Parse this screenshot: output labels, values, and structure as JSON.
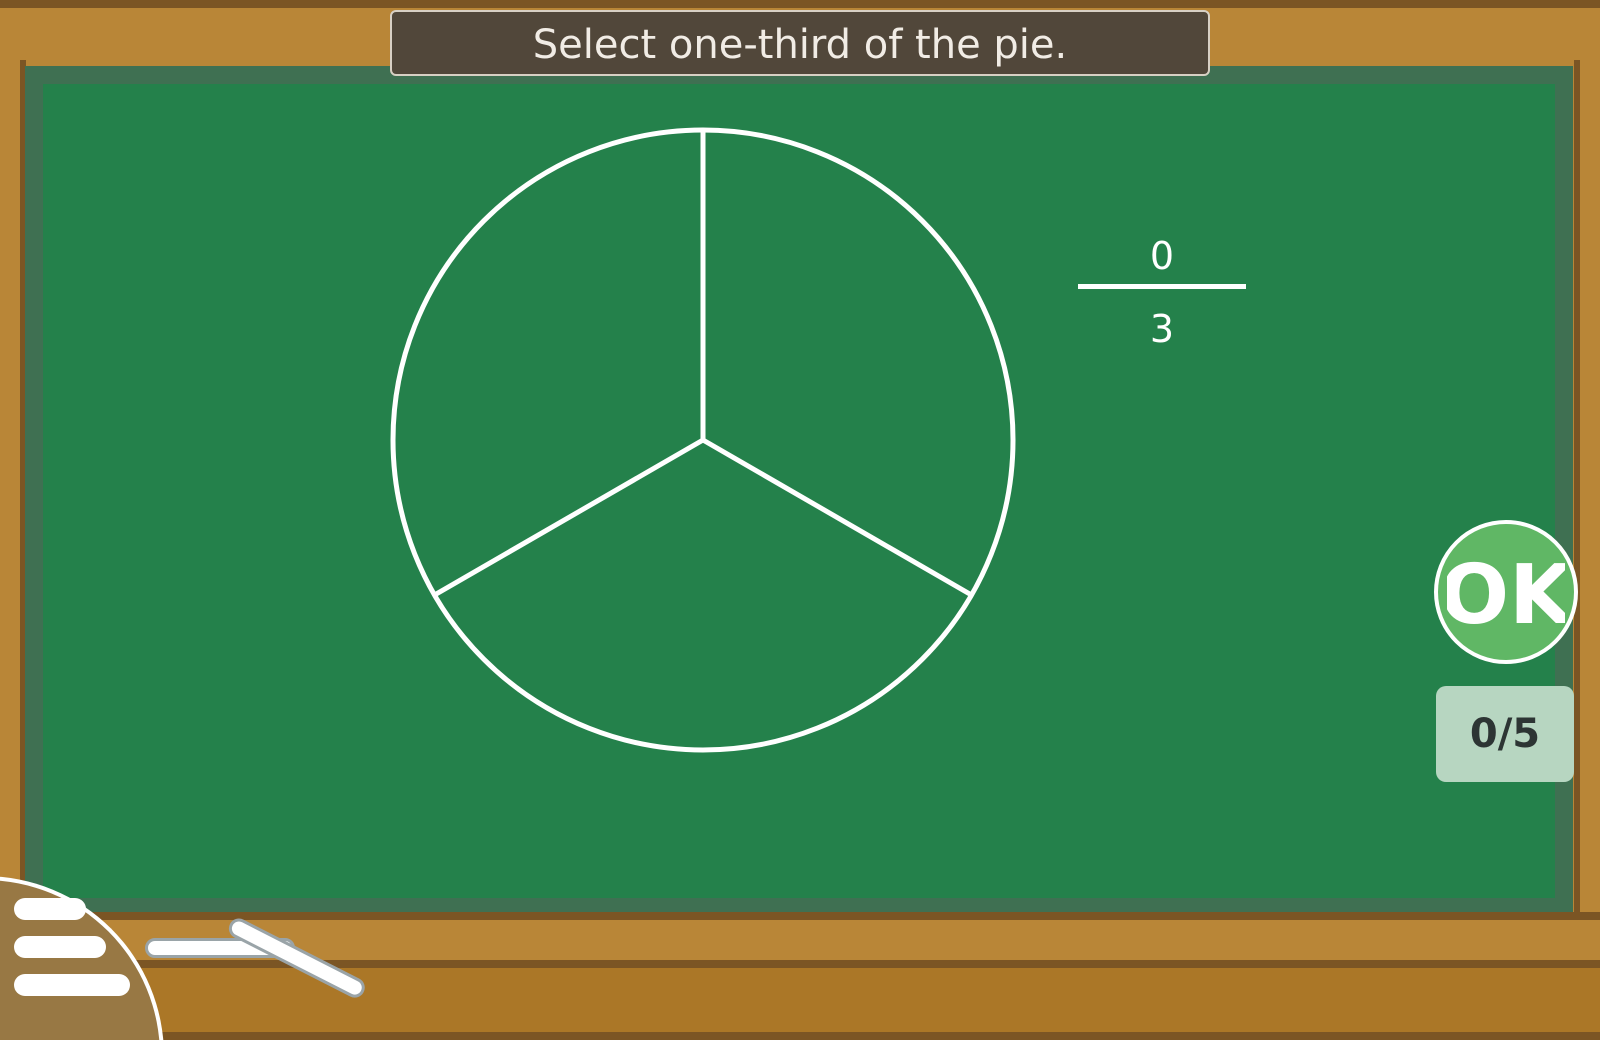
{
  "prompt": "Select one-third of the pie.",
  "fraction": {
    "numerator": "0",
    "denominator": "3"
  },
  "pie": {
    "slices": 3,
    "selected": 0
  },
  "ok_button": {
    "label": "OK"
  },
  "score": "0/5",
  "colors": {
    "board": "#24814b",
    "board_edge": "#3f7052",
    "frame": "#b98637",
    "frame_dark": "#7b5524",
    "banner": "#51473a",
    "ok_button": "#60b765",
    "score_box": "#b7d6c1"
  },
  "icons": {
    "menu": "hamburger-menu-icon",
    "chalk": "chalk-piece"
  }
}
